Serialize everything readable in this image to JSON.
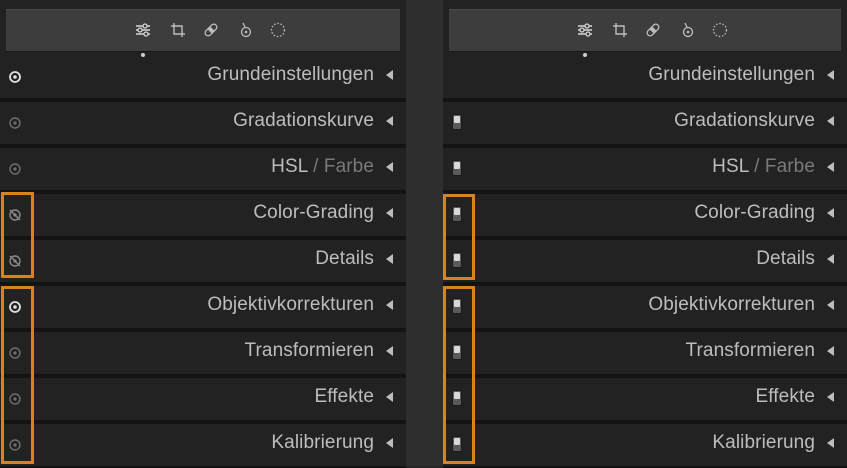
{
  "theme": {
    "highlight_color": "#d9821e",
    "panel_bg": "#222222",
    "text_color": "#bdbdbd",
    "dim_text_color": "#7a7a7a"
  },
  "toolbar": {
    "tools": [
      {
        "name": "sliders-icon",
        "active": true
      },
      {
        "name": "crop-icon",
        "active": false
      },
      {
        "name": "bandage-icon",
        "active": false
      },
      {
        "name": "brush-pin-icon",
        "active": false
      },
      {
        "name": "dotted-circle-icon",
        "active": false
      }
    ]
  },
  "panels": {
    "left": {
      "control_type": "eye-toggle",
      "sections": [
        {
          "label": "Grundeinstellungen",
          "state": "on"
        },
        {
          "label": "Gradationskurve",
          "state": "dim"
        },
        {
          "label": "HSL",
          "sep": "/",
          "label2": "Farbe",
          "state": "dim"
        },
        {
          "label": "Color-Grading",
          "state": "off"
        },
        {
          "label": "Details",
          "state": "off"
        },
        {
          "label": "Objektivkorrekturen",
          "state": "on"
        },
        {
          "label": "Transformieren",
          "state": "dim"
        },
        {
          "label": "Effekte",
          "state": "dim"
        },
        {
          "label": "Kalibrierung",
          "state": "dim"
        }
      ]
    },
    "right": {
      "control_type": "switch",
      "sections": [
        {
          "label": "Grundeinstellungen",
          "switch": false
        },
        {
          "label": "Gradationskurve",
          "switch": true
        },
        {
          "label": "HSL",
          "sep": "/",
          "label2": "Farbe",
          "switch": true
        },
        {
          "label": "Color-Grading",
          "switch": true
        },
        {
          "label": "Details",
          "switch": true
        },
        {
          "label": "Objektivkorrekturen",
          "switch": true
        },
        {
          "label": "Transformieren",
          "switch": true
        },
        {
          "label": "Effekte",
          "switch": true
        },
        {
          "label": "Kalibrierung",
          "switch": true
        }
      ]
    }
  }
}
